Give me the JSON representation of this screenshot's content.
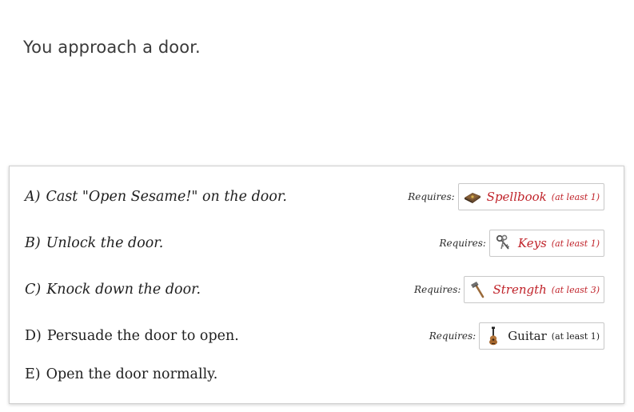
{
  "narration": "You approach a door.",
  "choices": [
    {
      "letter": "A)",
      "text": "Cast \"Open Sesame!\" on the door.",
      "requires_label": "Requires:",
      "requirement": {
        "name": "Spellbook",
        "qty": "(at least 1)",
        "icon": "spellbook-icon",
        "met": false
      }
    },
    {
      "letter": "B)",
      "text": "Unlock the door.",
      "requires_label": "Requires:",
      "requirement": {
        "name": "Keys",
        "qty": "(at least 1)",
        "icon": "keys-icon",
        "met": false
      }
    },
    {
      "letter": "C)",
      "text": "Knock down the door.",
      "requires_label": "Requires:",
      "requirement": {
        "name": "Strength",
        "qty": "(at least 3)",
        "icon": "hammer-icon",
        "met": false
      }
    },
    {
      "letter": "D)",
      "text": "Persuade the door to open.",
      "requires_label": "Requires:",
      "requirement": {
        "name": "Guitar",
        "qty": "(at least 1)",
        "icon": "guitar-icon",
        "met": true
      }
    },
    {
      "letter": "E)",
      "text": "Open the door normally."
    }
  ],
  "colors": {
    "unmet_requirement": "#c0232a",
    "met_requirement": "#222222"
  }
}
